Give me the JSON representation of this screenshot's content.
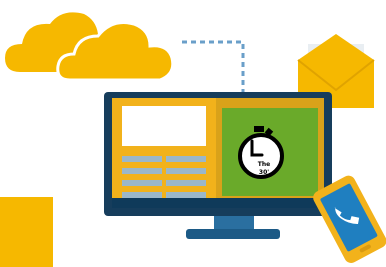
{
  "illustration": {
    "stopwatch_label_line1": "The",
    "stopwatch_label_line2": "30'"
  },
  "colors": {
    "cloud": "#f6b800",
    "monitor_frame": "#163d5c",
    "monitor_stand": "#2a6fa0",
    "screen_left": "#f2b21b",
    "screen_right_frame": "#d9a21a",
    "screen_green_panel": "#6aaa2a",
    "content_lines": "#9bb7c9",
    "envelope": "#f6b800",
    "paper": "#e9eef2",
    "connector_dash": "#6a9fc9",
    "phone_body": "#f2b21b",
    "phone_screen": "#1f7fc0",
    "orange_square": "#f6b800"
  },
  "icons": [
    "cloud-icon",
    "monitor-icon",
    "stopwatch-icon",
    "envelope-icon",
    "phone-icon"
  ]
}
